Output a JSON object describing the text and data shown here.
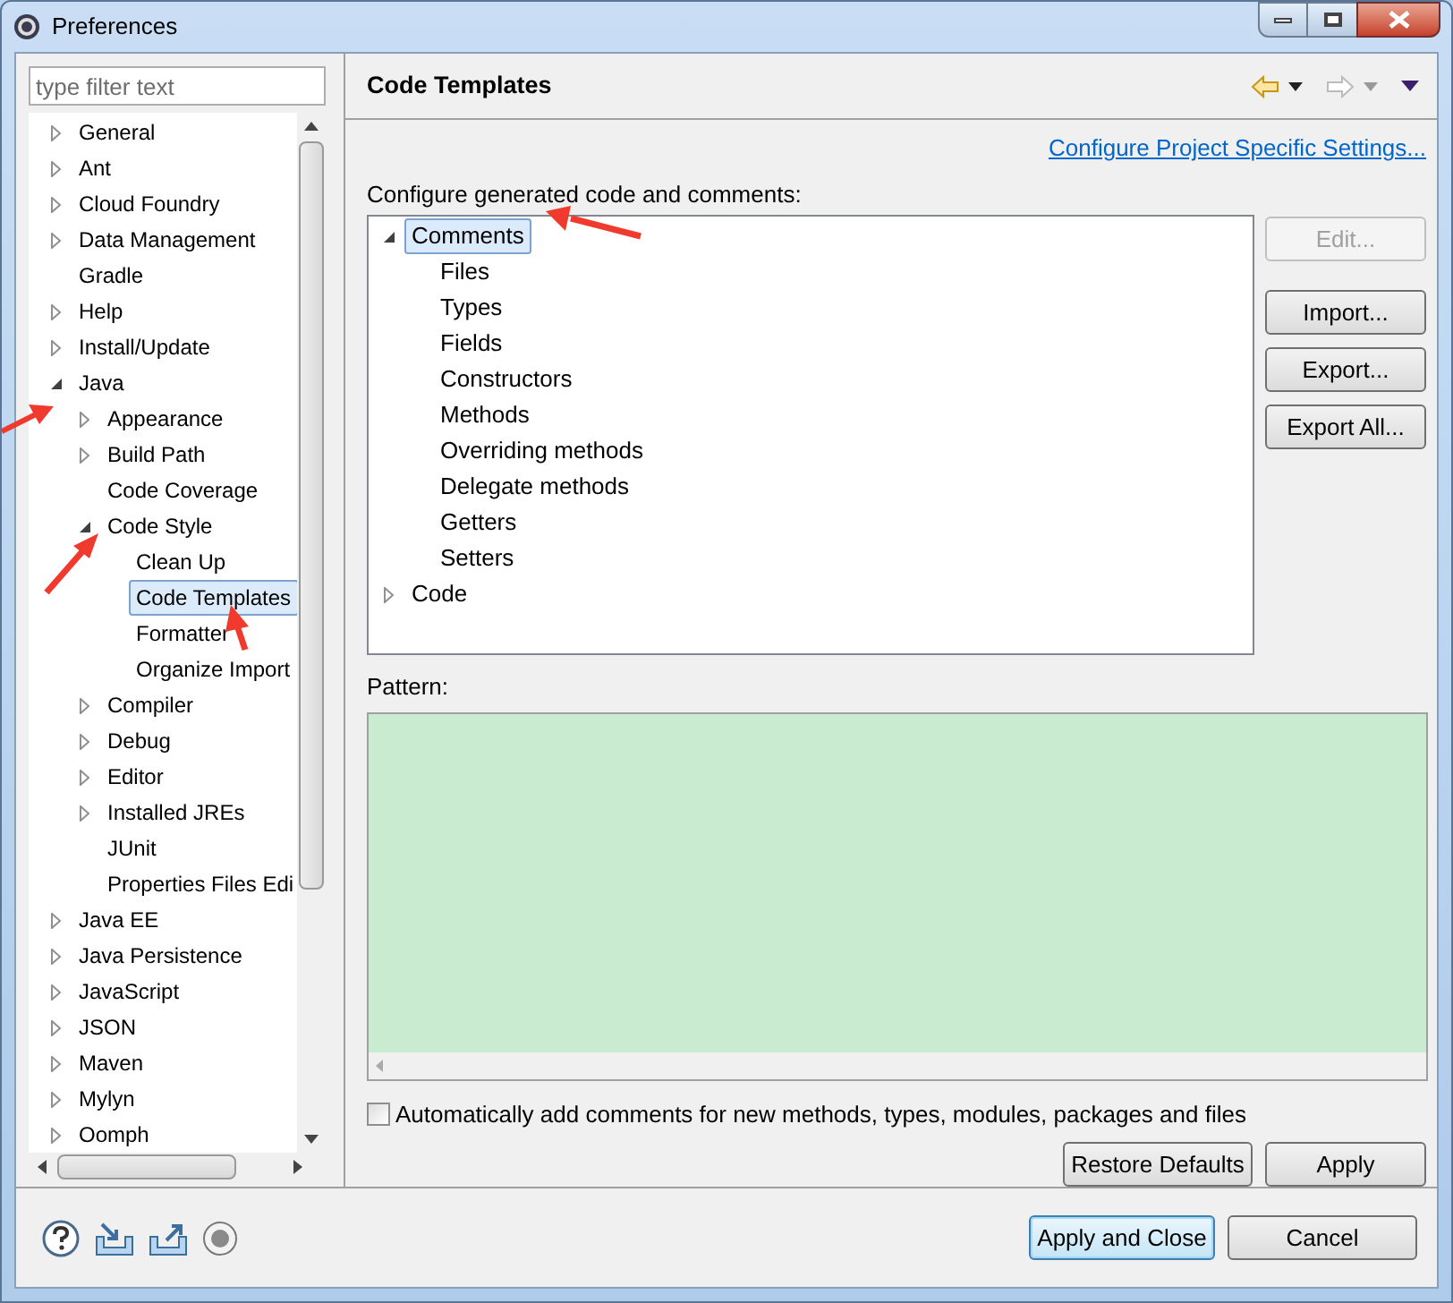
{
  "window": {
    "title": "Preferences"
  },
  "filter": {
    "placeholder": "type filter text"
  },
  "nav_tree": [
    {
      "label": "General",
      "expanded": false,
      "selected": false
    },
    {
      "label": "Ant",
      "expanded": false,
      "selected": false
    },
    {
      "label": "Cloud Foundry",
      "expanded": false,
      "selected": false
    },
    {
      "label": "Data Management",
      "expanded": false,
      "selected": false
    },
    {
      "label": "Gradle",
      "selected": false
    },
    {
      "label": "Help",
      "expanded": false,
      "selected": false
    },
    {
      "label": "Install/Update",
      "expanded": false,
      "selected": false
    },
    {
      "label": "Java",
      "expanded": true,
      "selected": false,
      "children": [
        {
          "label": "Appearance",
          "expanded": false,
          "selected": false
        },
        {
          "label": "Build Path",
          "expanded": false,
          "selected": false
        },
        {
          "label": "Code Coverage",
          "selected": false
        },
        {
          "label": "Code Style",
          "expanded": true,
          "selected": false,
          "children": [
            {
              "label": "Clean Up",
              "selected": false
            },
            {
              "label": "Code Templates",
              "selected": true
            },
            {
              "label": "Formatter",
              "selected": false
            },
            {
              "label": "Organize Import",
              "selected": false
            }
          ]
        },
        {
          "label": "Compiler",
          "expanded": false,
          "selected": false
        },
        {
          "label": "Debug",
          "expanded": false,
          "selected": false
        },
        {
          "label": "Editor",
          "expanded": false,
          "selected": false
        },
        {
          "label": "Installed JREs",
          "expanded": false,
          "selected": false
        },
        {
          "label": "JUnit",
          "selected": false
        },
        {
          "label": "Properties Files Edi",
          "selected": false
        }
      ]
    },
    {
      "label": "Java EE",
      "expanded": false,
      "selected": false
    },
    {
      "label": "Java Persistence",
      "expanded": false,
      "selected": false
    },
    {
      "label": "JavaScript",
      "expanded": false,
      "selected": false
    },
    {
      "label": "JSON",
      "expanded": false,
      "selected": false
    },
    {
      "label": "Maven",
      "expanded": false,
      "selected": false
    },
    {
      "label": "Mylyn",
      "expanded": false,
      "selected": false
    },
    {
      "label": "Oomph",
      "expanded": false,
      "selected": false
    }
  ],
  "page": {
    "title": "Code Templates",
    "link": "Configure Project Specific Settings...",
    "tree_label": "Configure generated code and comments:",
    "templates": [
      {
        "label": "Comments",
        "expanded": true,
        "selected": true,
        "children": [
          {
            "label": "Files",
            "selected": false
          },
          {
            "label": "Types",
            "selected": false
          },
          {
            "label": "Fields",
            "selected": false
          },
          {
            "label": "Constructors",
            "selected": false
          },
          {
            "label": "Methods",
            "selected": false
          },
          {
            "label": "Overriding methods",
            "selected": false
          },
          {
            "label": "Delegate methods",
            "selected": false
          },
          {
            "label": "Getters",
            "selected": false
          },
          {
            "label": "Setters",
            "selected": false
          }
        ]
      },
      {
        "label": "Code",
        "expanded": false,
        "selected": false
      }
    ],
    "side_buttons": [
      {
        "label": "Edit...",
        "disabled": true
      },
      {
        "label": "Import...",
        "disabled": false
      },
      {
        "label": "Export...",
        "disabled": false
      },
      {
        "label": "Export All...",
        "disabled": false
      }
    ],
    "pattern_label": "Pattern:",
    "auto_comments": {
      "label": "Automatically add comments for new methods, types, modules, packages and files",
      "checked": false
    },
    "restore_button": "Restore Defaults",
    "apply_button": "Apply"
  },
  "footer": {
    "apply_close": "Apply and Close",
    "cancel": "Cancel"
  }
}
